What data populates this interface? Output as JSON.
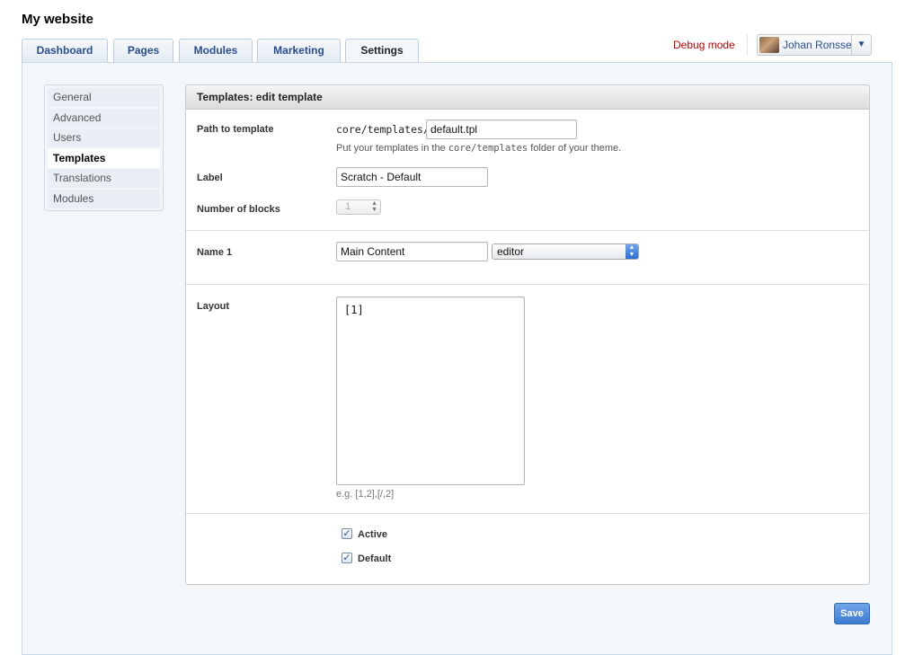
{
  "header": {
    "site_title": "My website",
    "debug_label": "Debug mode",
    "user_name": "Johan Ronsse",
    "user_caret": "▼"
  },
  "tabs": [
    {
      "label": "Dashboard"
    },
    {
      "label": "Pages"
    },
    {
      "label": "Modules"
    },
    {
      "label": "Marketing"
    },
    {
      "label": "Settings",
      "active": true
    }
  ],
  "subnav": {
    "items": [
      {
        "label": "General"
      },
      {
        "label": "Advanced"
      },
      {
        "label": "Users"
      },
      {
        "label": "Templates",
        "active": true
      },
      {
        "label": "Translations"
      },
      {
        "label": "Modules"
      }
    ]
  },
  "form": {
    "title": "Templates: edit template",
    "path": {
      "label": "Path to template",
      "prefix": "core/templates/",
      "value": "default.tpl",
      "help_before": "Put your templates in the ",
      "help_code": "core/templates",
      "help_after": " folder of your theme."
    },
    "label_field": {
      "label": "Label",
      "value": "Scratch - Default"
    },
    "blocks": {
      "label": "Number of blocks",
      "value": "1"
    },
    "name1": {
      "label": "Name 1",
      "value": "Main Content",
      "type_value": "editor"
    },
    "layout": {
      "label": "Layout",
      "value": "[1]",
      "help": "e.g. [1,2],[/,2]"
    },
    "checkboxes": [
      {
        "label": "Active",
        "checked": true
      },
      {
        "label": "Default",
        "checked": true
      }
    ],
    "save_label": "Save"
  },
  "colors": {
    "accent_blue": "#2a4d8f",
    "debug_red": "#c00000",
    "save_blue": "#3a7ad1"
  }
}
